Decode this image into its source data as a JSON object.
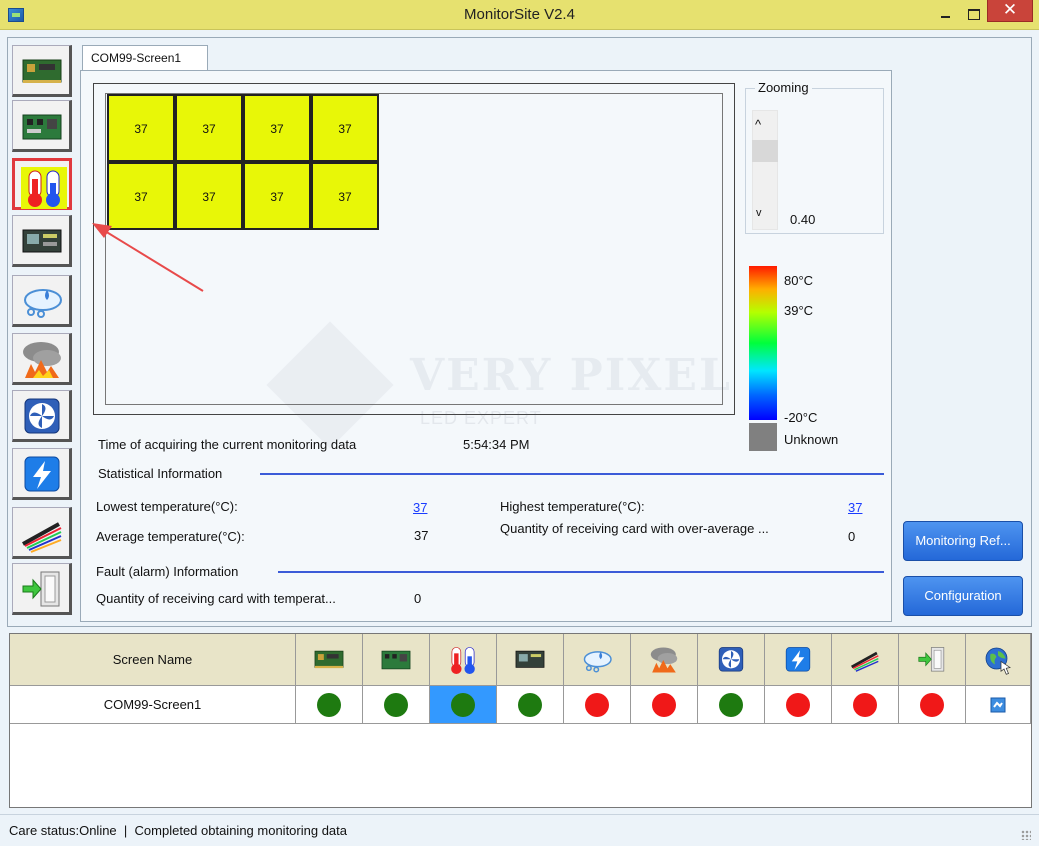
{
  "window": {
    "title": "MonitorSite V2.4",
    "close_glyph": "✕"
  },
  "sidebar": {
    "items": [
      {
        "icon": "sending-card-icon"
      },
      {
        "icon": "receiving-card-icon"
      },
      {
        "icon": "temperature-icon",
        "selected": true
      },
      {
        "icon": "monitoring-card-icon"
      },
      {
        "icon": "humidity-icon"
      },
      {
        "icon": "smoke-icon"
      },
      {
        "icon": "fan-icon"
      },
      {
        "icon": "power-icon"
      },
      {
        "icon": "cable-icon"
      },
      {
        "icon": "door-icon"
      }
    ]
  },
  "tabs": [
    {
      "label": "COM99-Screen1",
      "active": true
    }
  ],
  "screen": {
    "cells": [
      "37",
      "37",
      "37",
      "37",
      "37",
      "37",
      "37",
      "37"
    ],
    "cell_color": "#e8f707"
  },
  "watermark": {
    "main": "VERY PIXEL",
    "sub": "LED EXPERT"
  },
  "zoom": {
    "label": "Zooming",
    "up_glyph": "^",
    "down_glyph": "v",
    "value": "0.40"
  },
  "legend": {
    "max": "80°C",
    "mid": "39°C",
    "min": "-20°C",
    "unknown": "Unknown"
  },
  "info": {
    "time_label": "Time of acquiring the current monitoring data",
    "time_value": "5:54:34 PM",
    "stats_title": "Statistical Information",
    "lowest_label": "Lowest temperature(°C):",
    "lowest_value": "37",
    "highest_label": "Highest temperature(°C):",
    "highest_value": "37",
    "average_label": "Average temperature(°C):",
    "average_value": "37",
    "over_avg_label": "Quantity of receiving card with over-average ...",
    "over_avg_value": "0",
    "fault_title": "Fault (alarm) Information",
    "fault_label": "Quantity of receiving card with temperat...",
    "fault_value": "0"
  },
  "buttons": {
    "monitoring_refresh": "Monitoring Ref...",
    "configuration": "Configuration"
  },
  "table": {
    "name_header": "Screen Name",
    "rows": [
      {
        "name": "COM99-Screen1",
        "statuses": [
          "green",
          "green",
          "green",
          "green",
          "red",
          "red",
          "green",
          "red",
          "red",
          "red",
          "screen-icon"
        ]
      }
    ],
    "status_colors": {
      "green": "#1e7a10",
      "red": "#f01818",
      "selected": "#3399ff"
    }
  },
  "status": {
    "care_status": "Care status:Online",
    "separator": "|",
    "message": "Completed obtaining monitoring data"
  }
}
